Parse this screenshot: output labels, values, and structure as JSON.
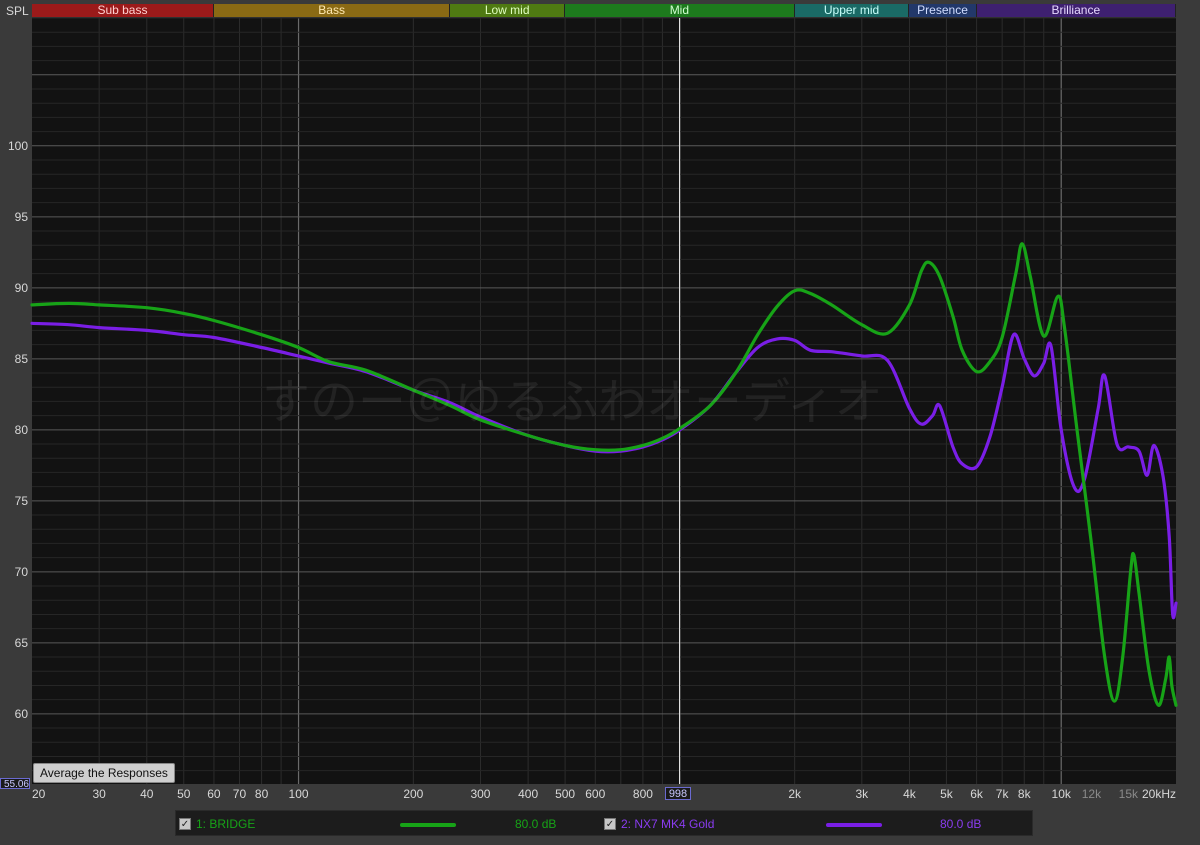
{
  "header": {
    "y_title": "SPL"
  },
  "bands": [
    {
      "label": "Sub bass",
      "from": 20,
      "to": 60,
      "bg": "#9b1a1a",
      "fg": "#ffd0d0"
    },
    {
      "label": "Bass",
      "from": 60,
      "to": 250,
      "bg": "#8a6a14",
      "fg": "#ffe9b0"
    },
    {
      "label": "Low mid",
      "from": 250,
      "to": 500,
      "bg": "#4f7a12",
      "fg": "#e0ffc0"
    },
    {
      "label": "Mid",
      "from": 500,
      "to": 2000,
      "bg": "#1d7a1d",
      "fg": "#d0ffd0"
    },
    {
      "label": "Upper mid",
      "from": 2000,
      "to": 4000,
      "bg": "#1a6a66",
      "fg": "#c8fffb"
    },
    {
      "label": "Presence",
      "from": 4000,
      "to": 6000,
      "bg": "#22386a",
      "fg": "#d0dcff"
    },
    {
      "label": "Brilliance",
      "from": 6000,
      "to": 20000,
      "bg": "#3e2070",
      "fg": "#e6d8ff"
    }
  ],
  "chart_data": {
    "type": "line",
    "xscale": "log",
    "xlim": [
      20,
      20000
    ],
    "ylim": [
      55.06,
      109
    ],
    "grid": true,
    "ylabel": "SPL",
    "yticks": [
      60,
      65,
      70,
      75,
      80,
      85,
      90,
      95,
      100
    ],
    "xticks": [
      {
        "v": 20,
        "l": "20"
      },
      {
        "v": 30,
        "l": "30"
      },
      {
        "v": 40,
        "l": "40"
      },
      {
        "v": 50,
        "l": "50"
      },
      {
        "v": 60,
        "l": "60"
      },
      {
        "v": 70,
        "l": "70"
      },
      {
        "v": 80,
        "l": "80"
      },
      {
        "v": 100,
        "l": "100"
      },
      {
        "v": 200,
        "l": "200"
      },
      {
        "v": 300,
        "l": "300"
      },
      {
        "v": 400,
        "l": "400"
      },
      {
        "v": 500,
        "l": "500"
      },
      {
        "v": 600,
        "l": "600"
      },
      {
        "v": 800,
        "l": "800"
      },
      {
        "v": 2000,
        "l": "2k"
      },
      {
        "v": 3000,
        "l": "3k"
      },
      {
        "v": 4000,
        "l": "4k"
      },
      {
        "v": 5000,
        "l": "5k"
      },
      {
        "v": 6000,
        "l": "6k"
      },
      {
        "v": 7000,
        "l": "7k"
      },
      {
        "v": 8000,
        "l": "8k"
      },
      {
        "v": 10000,
        "l": "10k"
      },
      {
        "v": 12000,
        "l": "12k"
      },
      {
        "v": 15000,
        "l": "15k"
      },
      {
        "v": 20000,
        "l": "20kHz"
      }
    ],
    "cursor": {
      "x": 998,
      "x_label": "998",
      "y_label": "55.06"
    },
    "series": [
      {
        "name": "1: BRIDGE",
        "color": "#17a317",
        "offset": "80.0 dB",
        "points": [
          [
            20,
            88.8
          ],
          [
            25,
            88.9
          ],
          [
            30,
            88.8
          ],
          [
            40,
            88.6
          ],
          [
            50,
            88.2
          ],
          [
            60,
            87.7
          ],
          [
            80,
            86.7
          ],
          [
            100,
            85.8
          ],
          [
            120,
            84.8
          ],
          [
            150,
            84.2
          ],
          [
            200,
            82.8
          ],
          [
            250,
            81.7
          ],
          [
            300,
            80.7
          ],
          [
            400,
            79.6
          ],
          [
            500,
            78.9
          ],
          [
            600,
            78.6
          ],
          [
            700,
            78.6
          ],
          [
            800,
            78.9
          ],
          [
            900,
            79.4
          ],
          [
            1000,
            80.1
          ],
          [
            1200,
            81.7
          ],
          [
            1400,
            84.0
          ],
          [
            1600,
            86.7
          ],
          [
            1800,
            88.7
          ],
          [
            2000,
            89.8
          ],
          [
            2200,
            89.6
          ],
          [
            2500,
            88.8
          ],
          [
            3000,
            87.4
          ],
          [
            3500,
            86.8
          ],
          [
            4000,
            88.8
          ],
          [
            4300,
            91.2
          ],
          [
            4500,
            91.8
          ],
          [
            4800,
            90.8
          ],
          [
            5200,
            88.0
          ],
          [
            5500,
            85.6
          ],
          [
            6000,
            84.1
          ],
          [
            6500,
            84.8
          ],
          [
            7000,
            86.5
          ],
          [
            7600,
            91.0
          ],
          [
            7900,
            93.1
          ],
          [
            8300,
            90.8
          ],
          [
            9000,
            86.6
          ],
          [
            9800,
            89.4
          ],
          [
            10200,
            87.2
          ],
          [
            11000,
            80.0
          ],
          [
            12000,
            72.0
          ],
          [
            13000,
            64.0
          ],
          [
            13800,
            60.9
          ],
          [
            14500,
            64.0
          ],
          [
            15200,
            70.0
          ],
          [
            15500,
            71.2
          ],
          [
            16000,
            68.5
          ],
          [
            17000,
            63.0
          ],
          [
            18000,
            60.6
          ],
          [
            18800,
            62.5
          ],
          [
            19200,
            64.0
          ],
          [
            19500,
            62.0
          ],
          [
            20000,
            60.6
          ]
        ]
      },
      {
        "name": "2: NX7 MK4 Gold",
        "color": "#7a1ee6",
        "offset": "80.0 dB",
        "points": [
          [
            20,
            87.5
          ],
          [
            25,
            87.4
          ],
          [
            30,
            87.2
          ],
          [
            40,
            87.0
          ],
          [
            50,
            86.7
          ],
          [
            60,
            86.5
          ],
          [
            80,
            85.8
          ],
          [
            100,
            85.2
          ],
          [
            120,
            84.7
          ],
          [
            150,
            84.1
          ],
          [
            200,
            82.8
          ],
          [
            250,
            81.9
          ],
          [
            300,
            80.9
          ],
          [
            400,
            79.6
          ],
          [
            500,
            78.9
          ],
          [
            600,
            78.5
          ],
          [
            700,
            78.5
          ],
          [
            800,
            78.8
          ],
          [
            900,
            79.3
          ],
          [
            1000,
            80.0
          ],
          [
            1200,
            81.7
          ],
          [
            1400,
            84.0
          ],
          [
            1600,
            85.8
          ],
          [
            1800,
            86.4
          ],
          [
            2000,
            86.3
          ],
          [
            2200,
            85.6
          ],
          [
            2500,
            85.5
          ],
          [
            3000,
            85.2
          ],
          [
            3500,
            84.9
          ],
          [
            4000,
            81.5
          ],
          [
            4300,
            80.4
          ],
          [
            4600,
            81.0
          ],
          [
            4800,
            81.7
          ],
          [
            5200,
            78.8
          ],
          [
            5500,
            77.6
          ],
          [
            6000,
            77.4
          ],
          [
            6500,
            79.5
          ],
          [
            7000,
            83.0
          ],
          [
            7500,
            86.7
          ],
          [
            8000,
            85.0
          ],
          [
            8500,
            83.8
          ],
          [
            9000,
            84.7
          ],
          [
            9400,
            85.9
          ],
          [
            10000,
            80.0
          ],
          [
            10800,
            76.0
          ],
          [
            11500,
            76.5
          ],
          [
            12500,
            81.5
          ],
          [
            13000,
            83.8
          ],
          [
            14000,
            79.0
          ],
          [
            15000,
            78.8
          ],
          [
            16000,
            78.5
          ],
          [
            16800,
            76.8
          ],
          [
            17500,
            78.9
          ],
          [
            18500,
            76.7
          ],
          [
            19200,
            72.5
          ],
          [
            19600,
            67.0
          ],
          [
            20000,
            67.8
          ]
        ]
      }
    ]
  },
  "legend": [
    {
      "checked": "✓",
      "name": "1: BRIDGE",
      "offset": "80.0 dB",
      "color": "#17a317"
    },
    {
      "checked": "✓",
      "name": "2: NX7 MK4 Gold",
      "offset": "80.0 dB",
      "color": "#7a1ee6"
    }
  ],
  "controls": {
    "average_label": "Average the Responses"
  },
  "watermark": "すのー＠ゆるふわオーディオ"
}
